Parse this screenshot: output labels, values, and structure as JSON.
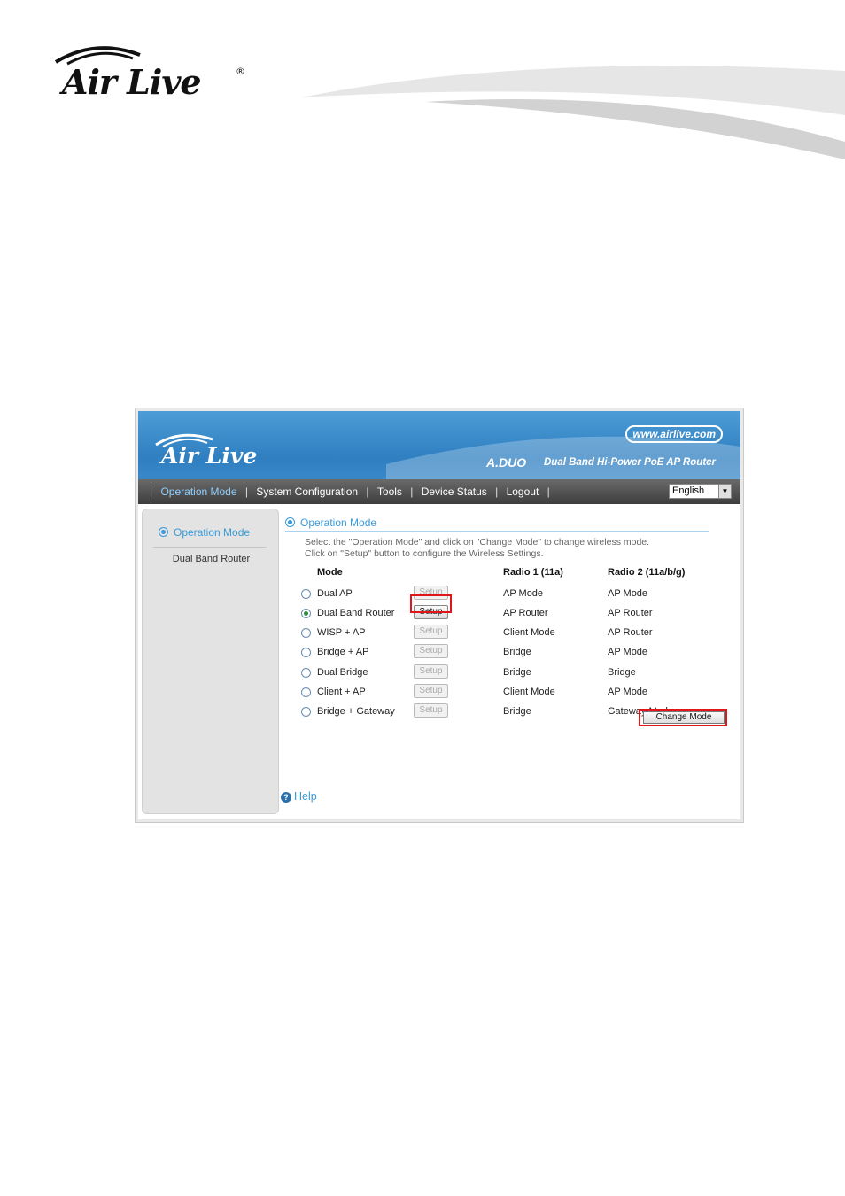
{
  "page": {
    "logo_text": "Air Live",
    "logo_mark": "®"
  },
  "app": {
    "url_badge": "www.airlive.com",
    "brand": "Air Live",
    "model": "A.DUO",
    "tagline": "Dual Band Hi-Power PoE AP Router"
  },
  "nav": {
    "items": [
      {
        "label": "Operation Mode",
        "active": true
      },
      {
        "label": "System Configuration",
        "active": false
      },
      {
        "label": "Tools",
        "active": false
      },
      {
        "label": "Device Status",
        "active": false
      },
      {
        "label": "Logout",
        "active": false
      }
    ],
    "separator": "|",
    "language": "English",
    "language_arrow_icon": "chevron-down-icon"
  },
  "sidebar": {
    "heading": "Operation Mode",
    "sub_item": "Dual Band Router"
  },
  "main": {
    "title": "Operation Mode",
    "description_line1": "Select the \"Operation Mode\" and click on \"Change Mode\" to change wireless mode.",
    "description_line2": "Click on \"Setup\" button to configure the Wireless Settings.",
    "columns": {
      "mode": "Mode",
      "radio1": "Radio 1 (11a)",
      "radio2": "Radio 2 (11a/b/g)"
    },
    "rows": [
      {
        "mode": "Dual AP",
        "setup": "Setup",
        "radio1": "AP Mode",
        "radio2": "AP Mode",
        "selected": false
      },
      {
        "mode": "Dual Band Router",
        "setup": "Setup",
        "radio1": "AP Router",
        "radio2": "AP Router",
        "selected": true
      },
      {
        "mode": "WISP + AP",
        "setup": "Setup",
        "radio1": "Client Mode",
        "radio2": "AP Router",
        "selected": false
      },
      {
        "mode": "Bridge + AP",
        "setup": "Setup",
        "radio1": "Bridge",
        "radio2": "AP Mode",
        "selected": false
      },
      {
        "mode": "Dual Bridge",
        "setup": "Setup",
        "radio1": "Bridge",
        "radio2": "Bridge",
        "selected": false
      },
      {
        "mode": "Client + AP",
        "setup": "Setup",
        "radio1": "Client Mode",
        "radio2": "AP Mode",
        "selected": false
      },
      {
        "mode": "Bridge + Gateway",
        "setup": "Setup",
        "radio1": "Bridge",
        "radio2": "Gateway Mode",
        "selected": false
      }
    ],
    "change_mode": "Change Mode",
    "help": "Help"
  },
  "colors": {
    "accent": "#3a9ad9",
    "highlight": "#e0161b",
    "banner": "#2f7fc1"
  }
}
